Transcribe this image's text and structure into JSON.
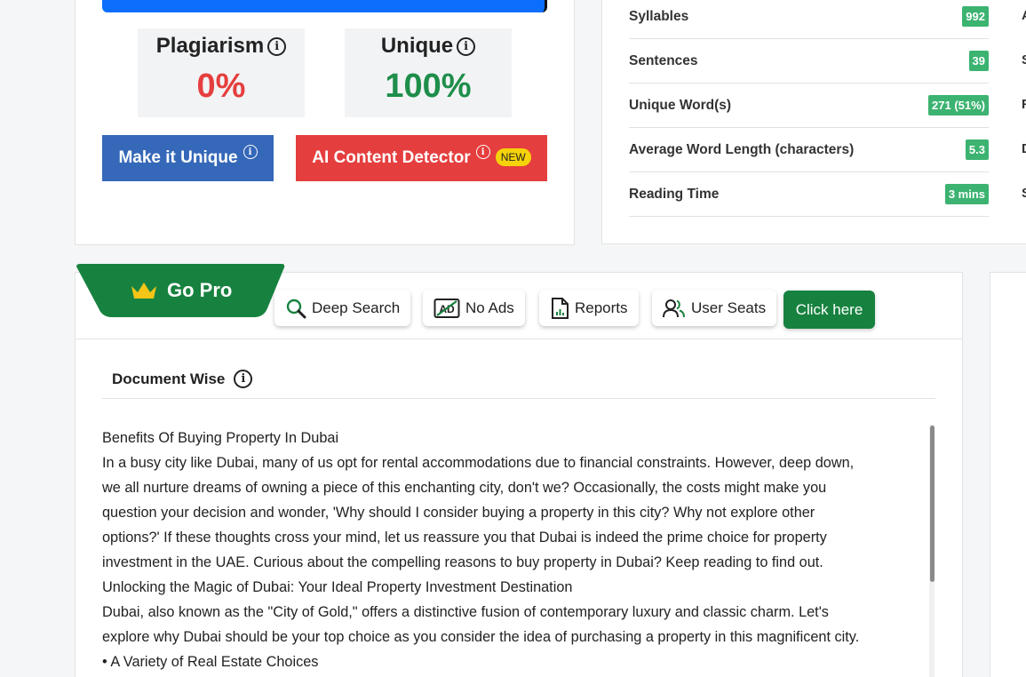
{
  "result": {
    "plagiarism_label": "Plagiarism",
    "plagiarism_value": "0%",
    "unique_label": "Unique",
    "unique_value": "100%",
    "make_unique_label": "Make it Unique",
    "ai_detector_label": "AI Content Detector",
    "new_badge": "NEW",
    "progress_fraction": 1.0
  },
  "text_stats": [
    {
      "label": "Syllables",
      "value": "992"
    },
    {
      "label": "Sentences",
      "value": "39"
    },
    {
      "label": "Unique Word(s)",
      "value": "271 (51%)"
    },
    {
      "label": "Average Word Length (characters)",
      "value": "5.3"
    },
    {
      "label": "Reading Time",
      "value": "3 mins"
    }
  ],
  "edge_letters": [
    "A",
    "S",
    "F",
    "D",
    "S"
  ],
  "pro": {
    "title": "Go Pro",
    "features": [
      {
        "label": "Deep Search",
        "icon": "search-icon"
      },
      {
        "label": "No Ads",
        "icon": "no-ads-icon"
      },
      {
        "label": "Reports",
        "icon": "report-icon"
      },
      {
        "label": "User Seats",
        "icon": "users-icon"
      }
    ],
    "cta_label": "Click here"
  },
  "document": {
    "tab_label": "Document Wise",
    "lines": [
      "Benefits Of Buying Property In Dubai",
      "In a busy city like Dubai, many of us opt for rental accommodations due to financial constraints. However, deep down,",
      "we all nurture dreams of owning a piece of this enchanting city, don't we? Occasionally, the costs might make you",
      "question your decision and wonder, 'Why should I consider buying a property in this city? Why not explore other",
      "options?' If these thoughts cross your mind, let us reassure you that Dubai is indeed the prime choice for property",
      "investment in the UAE. Curious about the compelling reasons to buy property in Dubai? Keep reading to find out.",
      "Unlocking the Magic of Dubai: Your Ideal Property Investment Destination",
      "Dubai, also known as the \"City of Gold,\" offers a distinctive fusion of contemporary luxury and classic charm. Let's",
      "explore why Dubai should be your top choice as you consider the idea of purchasing a property in this magnificent city.",
      "• A Variety of Real Estate Choices"
    ]
  },
  "colors": {
    "accent_blue": "#0d6efd",
    "unique_button": "#3568b8",
    "ai_button": "#e53e3e",
    "pro_green": "#17823f",
    "badge_green": "#3cb371",
    "new_badge": "#f5d20a"
  }
}
